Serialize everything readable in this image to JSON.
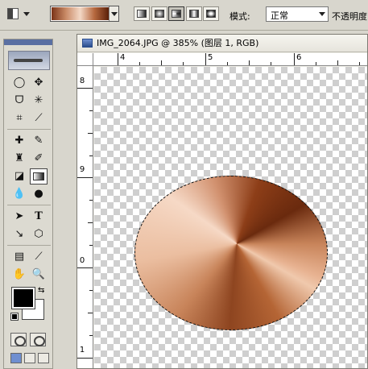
{
  "options_bar": {
    "tool_preset_icon": "gradient-tool-preset-icon",
    "gradient_colors": [
      "#7a3317",
      "#c98a66",
      "#f3d8c6",
      "#b6683e",
      "#5a200a"
    ],
    "gradient_types": [
      "linear",
      "radial",
      "angle",
      "reflected",
      "diamond"
    ],
    "selected_gradient_type": "angle",
    "mode_label": "模式:",
    "mode_value": "正常",
    "opacity_label": "不透明度"
  },
  "tools": {
    "foreground_color": "#000000",
    "background_color": "#ffffff",
    "selected_tool": "gradient-tool"
  },
  "document": {
    "title": "IMG_2064.JPG @ 385% (图层 1, RGB)",
    "ruler_top_labels": [
      "4",
      "5",
      "6"
    ],
    "ruler_left_labels": [
      "8",
      "9",
      "0",
      "1"
    ]
  },
  "canvas": {
    "shape": "ellipse-selection",
    "fill": "angle-gradient",
    "fill_colors": [
      "#6a2a0e",
      "#8e4520",
      "#c8845a",
      "#f0c9ad",
      "#f6d9c6"
    ]
  }
}
